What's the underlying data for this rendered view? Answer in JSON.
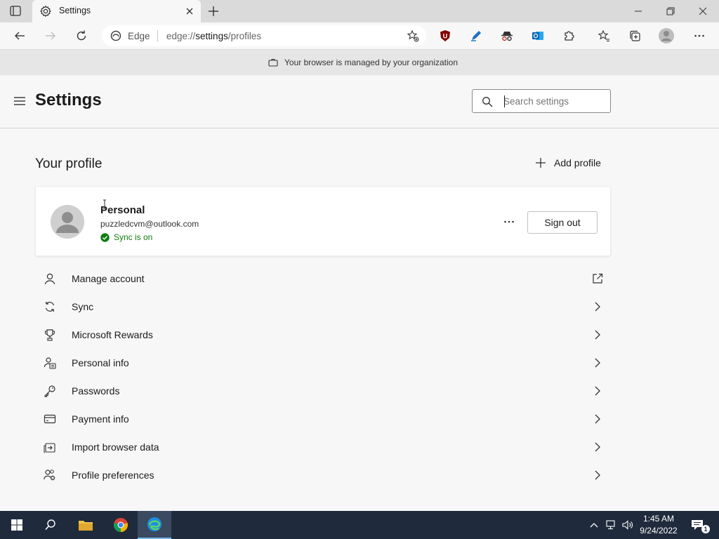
{
  "tab": {
    "title": "Settings"
  },
  "toolbar": {
    "edge_label": "Edge",
    "url_scheme": "edge://",
    "url_host": "settings",
    "url_path": "/profiles"
  },
  "managed_banner": {
    "text": "Your browser is managed by your organization"
  },
  "header": {
    "title": "Settings",
    "search_placeholder": "Search settings"
  },
  "profile_section": {
    "title": "Your profile",
    "add_profile_label": "Add profile",
    "name": "Personal",
    "email": "puzzledcvm@outlook.com",
    "sync_status": "Sync is on",
    "sign_out_label": "Sign out"
  },
  "menu": {
    "items": [
      {
        "label": "Manage account",
        "icon": "person-icon",
        "trail": "open-external-icon"
      },
      {
        "label": "Sync",
        "icon": "sync-icon",
        "trail": "chevron-right-icon"
      },
      {
        "label": "Microsoft Rewards",
        "icon": "trophy-icon",
        "trail": "chevron-right-icon"
      },
      {
        "label": "Personal info",
        "icon": "contact-card-icon",
        "trail": "chevron-right-icon"
      },
      {
        "label": "Passwords",
        "icon": "key-icon",
        "trail": "chevron-right-icon"
      },
      {
        "label": "Payment info",
        "icon": "credit-card-icon",
        "trail": "chevron-right-icon"
      },
      {
        "label": "Import browser data",
        "icon": "import-icon",
        "trail": "chevron-right-icon"
      },
      {
        "label": "Profile preferences",
        "icon": "people-settings-icon",
        "trail": "chevron-right-icon"
      }
    ]
  },
  "taskbar": {
    "time": "1:45 AM",
    "date": "9/24/2022",
    "notification_count": "1"
  },
  "colors": {
    "sync_green": "#107c10",
    "taskbar": "#1f2b3c",
    "tab_strip": "#dadada",
    "banner": "#e6e6e6"
  }
}
